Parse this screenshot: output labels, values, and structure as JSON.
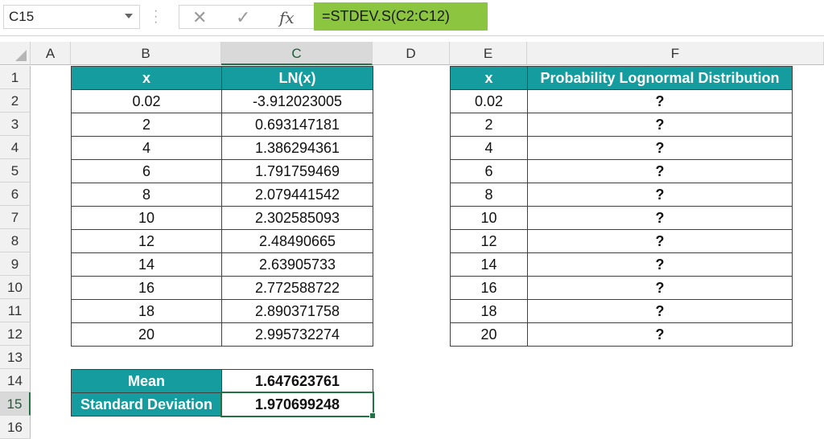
{
  "formula_bar": {
    "name_box": "C15",
    "cancel_icon": "✕",
    "enter_icon": "✓",
    "fx_label": "fx",
    "formula": "=STDEV.S(C2:C12)"
  },
  "columns": [
    "A",
    "B",
    "C",
    "D",
    "E",
    "F"
  ],
  "rows": [
    "1",
    "2",
    "3",
    "4",
    "5",
    "6",
    "7",
    "8",
    "9",
    "10",
    "11",
    "12",
    "13",
    "14",
    "15",
    "16"
  ],
  "table1": {
    "headers": [
      "x",
      "LN(x)"
    ],
    "x": [
      "0.02",
      "2",
      "4",
      "6",
      "8",
      "10",
      "12",
      "14",
      "16",
      "18",
      "20"
    ],
    "ln": [
      "-3.912023005",
      "0.693147181",
      "1.386294361",
      "1.791759469",
      "2.079441542",
      "2.302585093",
      "2.48490665",
      "2.63905733",
      "2.772588722",
      "2.890371758",
      "2.995732274"
    ]
  },
  "table2": {
    "headers": [
      "x",
      "Probability Lognormal Distribution"
    ],
    "x": [
      "0.02",
      "2",
      "4",
      "6",
      "8",
      "10",
      "12",
      "14",
      "16",
      "18",
      "20"
    ],
    "prob": [
      "?",
      "?",
      "?",
      "?",
      "?",
      "?",
      "?",
      "?",
      "?",
      "?",
      "?"
    ]
  },
  "summary": {
    "mean_label": "Mean",
    "mean_value": "1.647623761",
    "sd_label": "Standard Deviation",
    "sd_value": "1.970699248"
  },
  "colors": {
    "header_fill": "#149c9e",
    "formula_highlight": "#8cc640",
    "selection": "#217346"
  }
}
